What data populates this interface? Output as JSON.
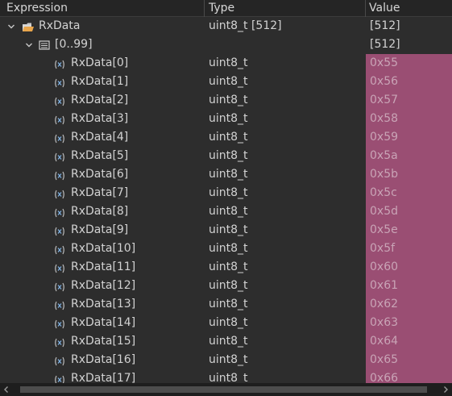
{
  "header": {
    "expression": "Expression",
    "type": "Type",
    "value": "Value"
  },
  "root": {
    "expression": "RxData",
    "type": "uint8_t [512]",
    "value": "[512]",
    "icon": "array-folder-icon"
  },
  "range": {
    "expression": "[0..99]",
    "type": "",
    "value": "[512]",
    "icon": "array-range-icon"
  },
  "elements": [
    {
      "expression": "RxData[0]",
      "type": "uint8_t",
      "value": "0x55"
    },
    {
      "expression": "RxData[1]",
      "type": "uint8_t",
      "value": "0x56"
    },
    {
      "expression": "RxData[2]",
      "type": "uint8_t",
      "value": "0x57"
    },
    {
      "expression": "RxData[3]",
      "type": "uint8_t",
      "value": "0x58"
    },
    {
      "expression": "RxData[4]",
      "type": "uint8_t",
      "value": "0x59"
    },
    {
      "expression": "RxData[5]",
      "type": "uint8_t",
      "value": "0x5a"
    },
    {
      "expression": "RxData[6]",
      "type": "uint8_t",
      "value": "0x5b"
    },
    {
      "expression": "RxData[7]",
      "type": "uint8_t",
      "value": "0x5c"
    },
    {
      "expression": "RxData[8]",
      "type": "uint8_t",
      "value": "0x5d"
    },
    {
      "expression": "RxData[9]",
      "type": "uint8_t",
      "value": "0x5e"
    },
    {
      "expression": "RxData[10]",
      "type": "uint8_t",
      "value": "0x5f"
    },
    {
      "expression": "RxData[11]",
      "type": "uint8_t",
      "value": "0x60"
    },
    {
      "expression": "RxData[12]",
      "type": "uint8_t",
      "value": "0x61"
    },
    {
      "expression": "RxData[13]",
      "type": "uint8_t",
      "value": "0x62"
    },
    {
      "expression": "RxData[14]",
      "type": "uint8_t",
      "value": "0x63"
    },
    {
      "expression": "RxData[15]",
      "type": "uint8_t",
      "value": "0x64"
    },
    {
      "expression": "RxData[16]",
      "type": "uint8_t",
      "value": "0x65"
    },
    {
      "expression": "RxData[17]",
      "type": "uint8_t",
      "value": "0x66"
    }
  ],
  "element_icon": "variable-icon",
  "colors": {
    "background": "#2d2d2d",
    "changed_value_highlight": "#9a4e73",
    "text": "#d2d2d2"
  }
}
